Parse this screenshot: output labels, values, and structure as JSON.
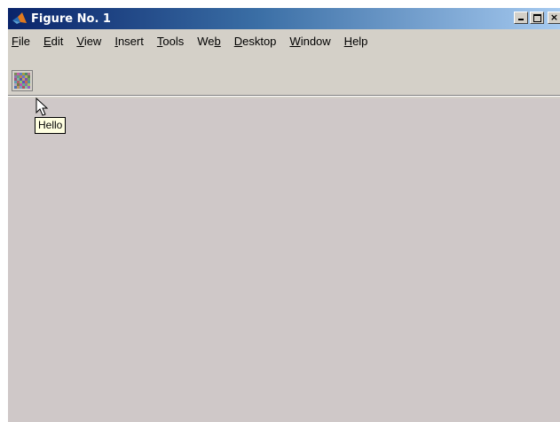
{
  "window": {
    "title": "Figure No. 1",
    "controls": {
      "minimize": "_",
      "maximize": "□",
      "close": "×"
    }
  },
  "menubar": {
    "items": [
      {
        "label": "File",
        "mnemonic": "F"
      },
      {
        "label": "Edit",
        "mnemonic": "E"
      },
      {
        "label": "View",
        "mnemonic": "V"
      },
      {
        "label": "Insert",
        "mnemonic": "I"
      },
      {
        "label": "Tools",
        "mnemonic": "T"
      },
      {
        "label": "Web",
        "mnemonic": "b"
      },
      {
        "label": "Desktop",
        "mnemonic": "D"
      },
      {
        "label": "Window",
        "mnemonic": "W"
      },
      {
        "label": "Help",
        "mnemonic": "H"
      }
    ]
  },
  "toolbar": {
    "button_icon": "noise-image-icon",
    "tooltip": "Hello"
  },
  "colors": {
    "title_start": "#0a246a",
    "title_end": "#a6caf0",
    "chrome": "#d4d0c8",
    "figure_background": "#cfc8c8",
    "tooltip_background": "#ffffe1"
  }
}
